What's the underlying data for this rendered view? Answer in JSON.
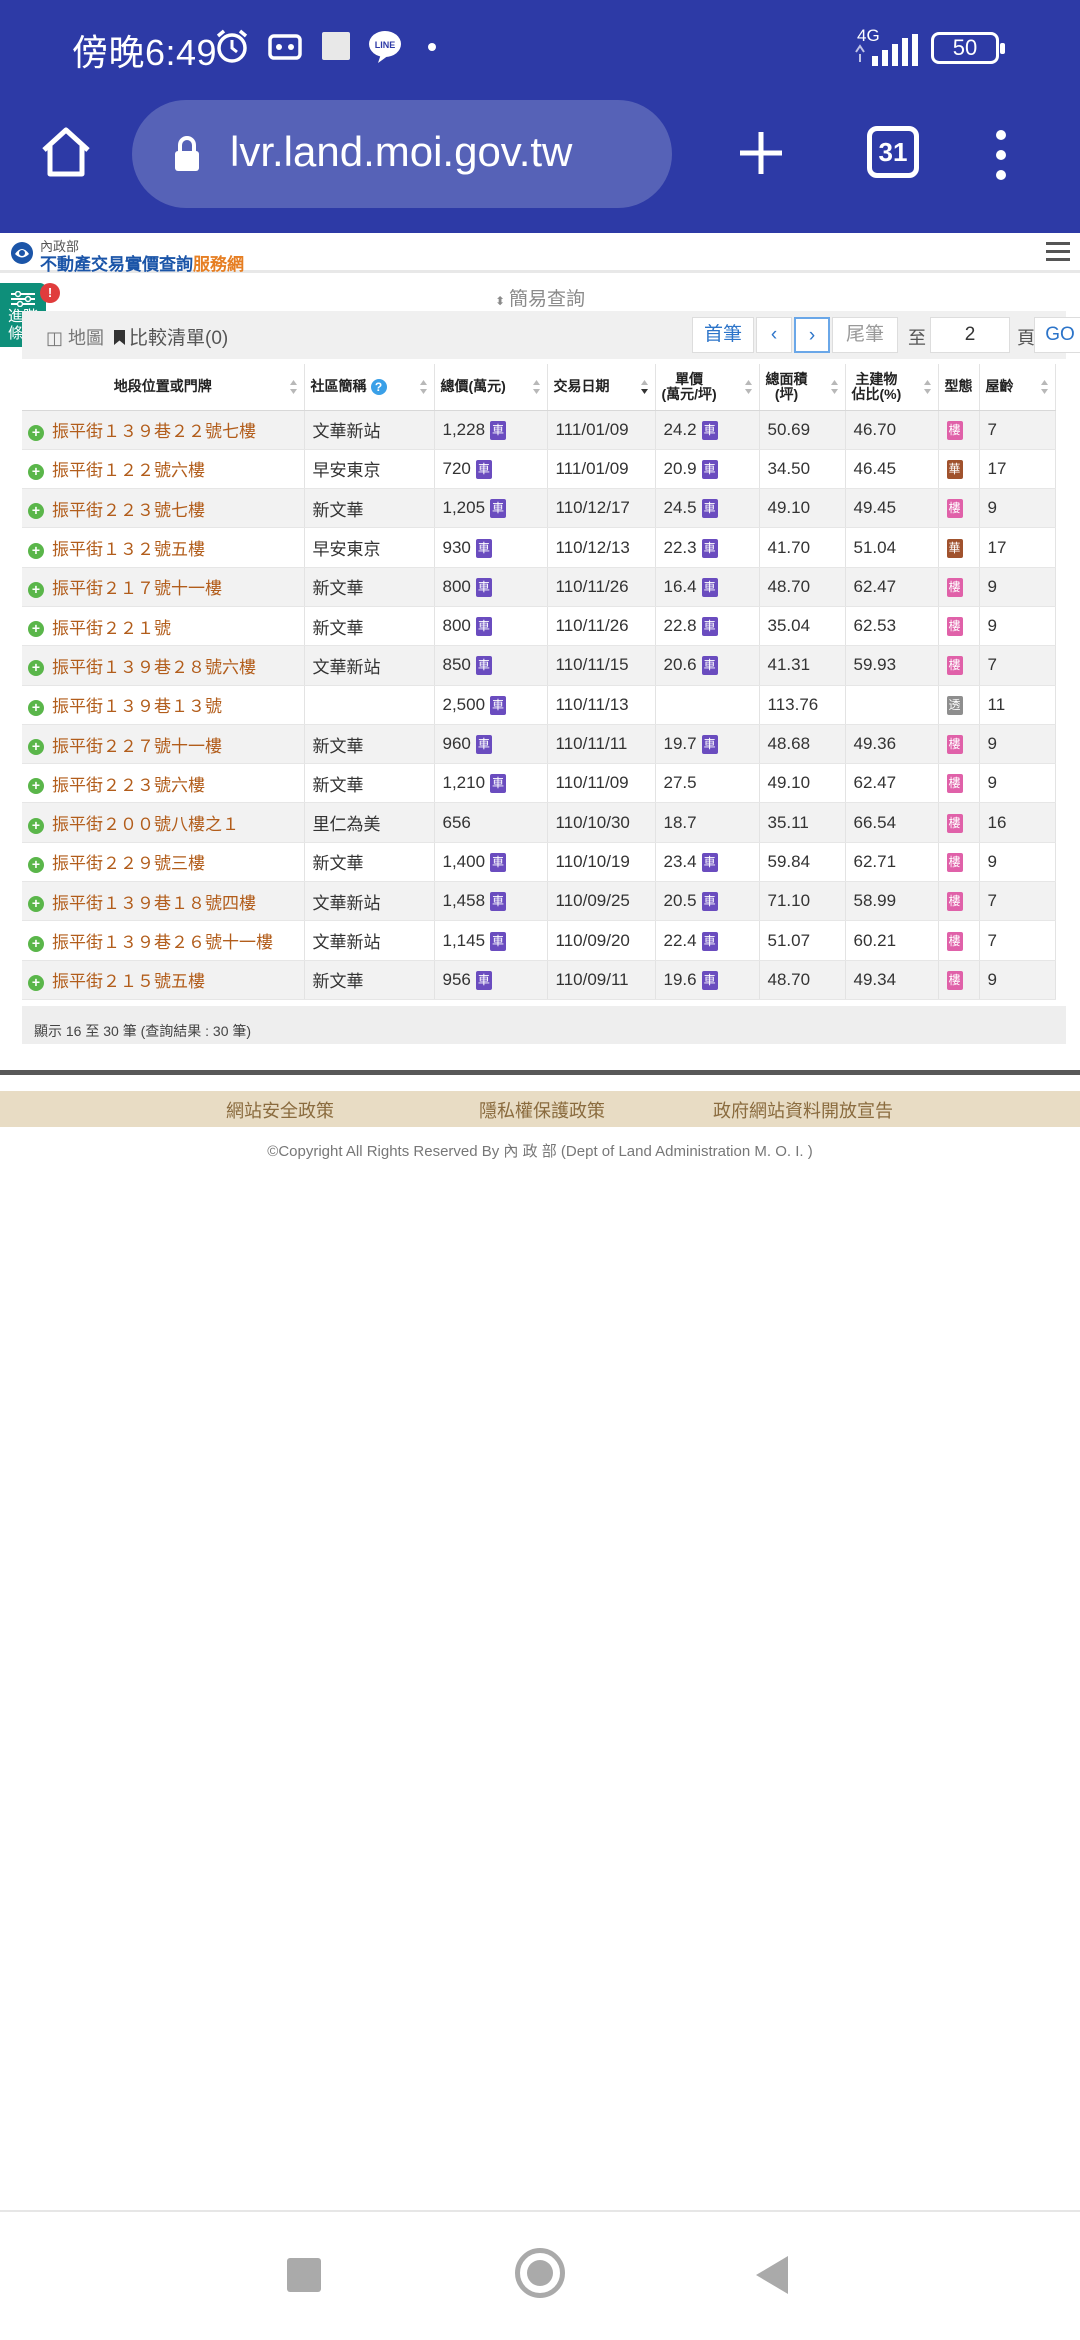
{
  "statusbar": {
    "time": "傍晚6:49",
    "network": "4G",
    "battery": "50"
  },
  "browser": {
    "url": "lvr.land.moi.gov.tw",
    "tab_count": "31"
  },
  "site": {
    "logo_small": "內政部",
    "logo_main": "不動產交易實價查詢",
    "logo_highlight": "服務網"
  },
  "filters": {
    "advanced_label_1": "進階",
    "advanced_label_2": "條件",
    "badge": "!",
    "simple_query": "簡易查詢",
    "map_label": "地圖",
    "compare_label": "比較清單(0)"
  },
  "pagination": {
    "first": "首筆",
    "prev": "‹",
    "next": "›",
    "last": "尾筆",
    "to_label": "至",
    "page_value": "2",
    "page_label": "頁",
    "go": "GO"
  },
  "table": {
    "headers": [
      "地段位置或門牌",
      "社區簡稱",
      "總價(萬元)",
      "交易日期",
      "單價\n(萬元/坪)",
      "總面積\n(坪)",
      "主建物\n佔比(%)",
      "型態",
      "屋齡"
    ],
    "rows": [
      {
        "addr": "振平街１３９巷２２號七樓",
        "community": "文華新站",
        "price": "1,228",
        "price_car": true,
        "date": "111/01/09",
        "unit": "24.2",
        "unit_car": true,
        "area": "50.69",
        "ratio": "46.70",
        "type": "樓",
        "type_color": "#e061a9",
        "age": "7"
      },
      {
        "addr": "振平街１２２號六樓",
        "community": "早安東京",
        "price": "720",
        "price_car": true,
        "date": "111/01/09",
        "unit": "20.9",
        "unit_car": true,
        "area": "34.50",
        "ratio": "46.45",
        "type": "華",
        "type_color": "#a0522d",
        "age": "17"
      },
      {
        "addr": "振平街２２３號七樓",
        "community": "新文華",
        "price": "1,205",
        "price_car": true,
        "date": "110/12/17",
        "unit": "24.5",
        "unit_car": true,
        "area": "49.10",
        "ratio": "49.45",
        "type": "樓",
        "type_color": "#e061a9",
        "age": "9"
      },
      {
        "addr": "振平街１３２號五樓",
        "community": "早安東京",
        "price": "930",
        "price_car": true,
        "date": "110/12/13",
        "unit": "22.3",
        "unit_car": true,
        "area": "41.70",
        "ratio": "51.04",
        "type": "華",
        "type_color": "#a0522d",
        "age": "17"
      },
      {
        "addr": "振平街２１７號十一樓",
        "community": "新文華",
        "price": "800",
        "price_car": true,
        "date": "110/11/26",
        "unit": "16.4",
        "unit_car": true,
        "area": "48.70",
        "ratio": "62.47",
        "type": "樓",
        "type_color": "#e061a9",
        "age": "9"
      },
      {
        "addr": "振平街２２１號",
        "community": "新文華",
        "price": "800",
        "price_car": true,
        "date": "110/11/26",
        "unit": "22.8",
        "unit_car": true,
        "area": "35.04",
        "ratio": "62.53",
        "type": "樓",
        "type_color": "#e061a9",
        "age": "9"
      },
      {
        "addr": "振平街１３９巷２８號六樓",
        "community": "文華新站",
        "price": "850",
        "price_car": true,
        "date": "110/11/15",
        "unit": "20.6",
        "unit_car": true,
        "area": "41.31",
        "ratio": "59.93",
        "type": "樓",
        "type_color": "#e061a9",
        "age": "7"
      },
      {
        "addr": "振平街１３９巷１３號",
        "community": "",
        "price": "2,500",
        "price_car": true,
        "date": "110/11/13",
        "unit": "",
        "unit_car": false,
        "area": "113.76",
        "ratio": "",
        "type": "透",
        "type_color": "#8e8e8e",
        "age": "11"
      },
      {
        "addr": "振平街２２７號十一樓",
        "community": "新文華",
        "price": "960",
        "price_car": true,
        "date": "110/11/11",
        "unit": "19.7",
        "unit_car": true,
        "area": "48.68",
        "ratio": "49.36",
        "type": "樓",
        "type_color": "#e061a9",
        "age": "9"
      },
      {
        "addr": "振平街２２３號六樓",
        "community": "新文華",
        "price": "1,210",
        "price_car": true,
        "date": "110/11/09",
        "unit": "27.5",
        "unit_car": false,
        "area": "49.10",
        "ratio": "62.47",
        "type": "樓",
        "type_color": "#e061a9",
        "age": "9"
      },
      {
        "addr": "振平街２００號八樓之１",
        "community": "里仁為美",
        "price": "656",
        "price_car": false,
        "date": "110/10/30",
        "unit": "18.7",
        "unit_car": false,
        "area": "35.11",
        "ratio": "66.54",
        "type": "樓",
        "type_color": "#e061a9",
        "age": "16"
      },
      {
        "addr": "振平街２２９號三樓",
        "community": "新文華",
        "price": "1,400",
        "price_car": true,
        "date": "110/10/19",
        "unit": "23.4",
        "unit_car": true,
        "area": "59.84",
        "ratio": "62.71",
        "type": "樓",
        "type_color": "#e061a9",
        "age": "9"
      },
      {
        "addr": "振平街１３９巷１８號四樓",
        "community": "文華新站",
        "price": "1,458",
        "price_car": true,
        "date": "110/09/25",
        "unit": "20.5",
        "unit_car": true,
        "area": "71.10",
        "ratio": "58.99",
        "type": "樓",
        "type_color": "#e061a9",
        "age": "7"
      },
      {
        "addr": "振平街１３９巷２６號十一樓",
        "community": "文華新站",
        "price": "1,145",
        "price_car": true,
        "date": "110/09/20",
        "unit": "22.4",
        "unit_car": true,
        "area": "51.07",
        "ratio": "60.21",
        "type": "樓",
        "type_color": "#e061a9",
        "age": "7"
      },
      {
        "addr": "振平街２１５號五樓",
        "community": "新文華",
        "price": "956",
        "price_car": true,
        "date": "110/09/11",
        "unit": "19.6",
        "unit_car": true,
        "area": "48.70",
        "ratio": "49.34",
        "type": "樓",
        "type_color": "#e061a9",
        "age": "9"
      }
    ],
    "car_badge": "車",
    "add_icon": "+",
    "summary": "顯示 16 至 30 筆 (查詢結果 : 30 筆)"
  },
  "footer": {
    "link_security": "網站安全政策",
    "link_privacy": "隱私權保護政策",
    "link_opendata": "政府網站資料開放宣告",
    "copyright": "©Copyright All Rights Reserved By 內 政 部 (Dept of Land Administration M. O. I. )"
  },
  "colors": {
    "brand_bar": "#2d3aa6",
    "address_link": "#b25d1b",
    "car_badge": "#6a4cbf",
    "advanced_tab": "#0e8f7a"
  }
}
